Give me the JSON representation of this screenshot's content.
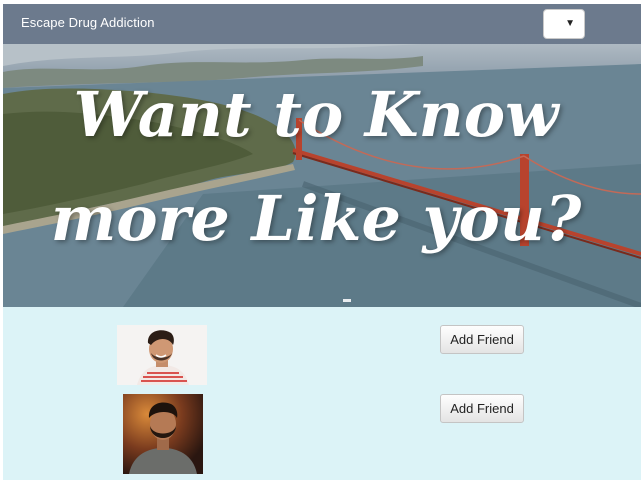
{
  "navbar": {
    "brand": "Escape Drug Addiction",
    "select": {
      "selected": "",
      "icon": "chevron-down-icon"
    }
  },
  "hero": {
    "headline_line1": "Want to Know",
    "headline_line2": "more Like you?"
  },
  "friends": [
    {
      "button_label": "Add Friend"
    },
    {
      "button_label": "Add Friend"
    }
  ],
  "colors": {
    "navbar_bg": "#6c7a8d",
    "content_bg": "#dcf3f7",
    "bridge": "#b8432d"
  }
}
